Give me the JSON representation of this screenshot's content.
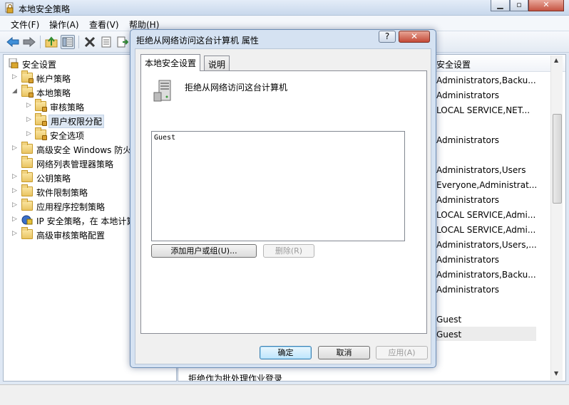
{
  "window": {
    "title": "本地安全策略"
  },
  "menu": [
    "文件(F)",
    "操作(A)",
    "查看(V)",
    "帮助(H)"
  ],
  "toolbar": {
    "icons": [
      "back-arrow-icon",
      "forward-arrow-icon",
      "up-folder-icon",
      "show-hide-tree-icon",
      "delete-icon",
      "properties-icon",
      "export-list-icon"
    ]
  },
  "tree": [
    {
      "label": "安全设置",
      "icon": "security-settings-icon",
      "expanded": true
    },
    {
      "label": "帐户策略",
      "icon": "folder-icon"
    },
    {
      "label": "本地策略",
      "icon": "folder-icon",
      "expanded": true
    },
    {
      "label": "审核策略",
      "icon": "folder-icon"
    },
    {
      "label": "用户权限分配",
      "icon": "folder-icon",
      "selected": true
    },
    {
      "label": "安全选项",
      "icon": "folder-icon"
    },
    {
      "label": "高级安全 Windows 防火",
      "icon": "folder-icon"
    },
    {
      "label": "网络列表管理器策略",
      "icon": "folder-icon"
    },
    {
      "label": "公钥策略",
      "icon": "folder-icon"
    },
    {
      "label": "软件限制策略",
      "icon": "folder-icon"
    },
    {
      "label": "应用程序控制策略",
      "icon": "folder-icon"
    },
    {
      "label": "IP 安全策略，在 本地计算",
      "icon": "ip-security-icon"
    },
    {
      "label": "高级审核策略配置",
      "icon": "folder-icon"
    }
  ],
  "right_pane": {
    "column_header": "安全设置",
    "rows": [
      "Administrators,Backu...",
      "Administrators",
      "LOCAL SERVICE,NET...",
      "",
      "Administrators",
      "",
      "Administrators,Users",
      "Everyone,Administrat...",
      "Administrators",
      "LOCAL SERVICE,Admi...",
      "LOCAL SERVICE,Admi...",
      "Administrators,Users,...",
      "Administrators",
      "Administrators,Backu...",
      "Administrators",
      "",
      "Guest",
      "Guest"
    ],
    "bottom_row_partial": "拒绝作为批处理作业登录"
  },
  "dialog": {
    "title": "拒绝从网络访问这台计算机 属性",
    "help_button": "?",
    "close_button": "✕",
    "tabs": [
      "本地安全设置",
      "说明"
    ],
    "policy_name": "拒绝从网络访问这台计算机",
    "list_entries": [
      "Guest"
    ],
    "add_button": "添加用户或组(U)...",
    "remove_button": "删除(R)",
    "ok_button": "确定",
    "cancel_button": "取消",
    "apply_button": "应用(A)"
  }
}
